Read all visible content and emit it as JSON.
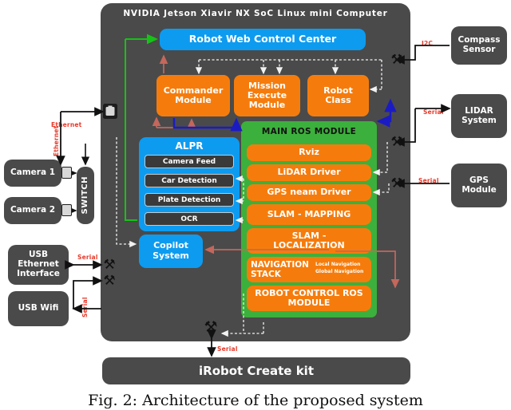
{
  "figure": {
    "caption": "Fig. 2: Architecture of the proposed system"
  },
  "soc": {
    "title": "NVIDIA Jetson Xiavir NX SoC Linux mini Computer",
    "web_control_center": "Robot Web Control Center",
    "modules": [
      {
        "label": "Commander Module"
      },
      {
        "label": "Mission Execute Module"
      },
      {
        "label": "Robot Class"
      }
    ],
    "alpr": {
      "title": "ALPR",
      "items": [
        "Camera Feed",
        "Car Detection",
        "Plate Detection",
        "OCR"
      ]
    },
    "copilot": "Copilot System",
    "ros": {
      "title": "MAIN ROS MODULE",
      "items": [
        {
          "label": "Rviz"
        },
        {
          "label": "LiDAR Driver"
        },
        {
          "label": "GPS neam Driver"
        },
        {
          "label": "SLAM - MAPPING"
        },
        {
          "label": "SLAM - LOCALIZATION"
        },
        {
          "label": "NAVIGATION STACK",
          "sub1": "Local Navigation",
          "sub2": "Global Navigation"
        },
        {
          "label": "ROBOT CONTROL ROS MODULE"
        }
      ]
    }
  },
  "left_devices": [
    {
      "label": "Camera 1"
    },
    {
      "label": "Camera 2"
    },
    {
      "label": "USB Ethernet Interface"
    },
    {
      "label": "USB Wifi"
    }
  ],
  "switch": {
    "label": "SWITCH"
  },
  "right_devices": [
    {
      "label": "Compass Sensor",
      "bus": "I2C"
    },
    {
      "label": "LIDAR System",
      "bus": "Serial"
    },
    {
      "label": "GPS Module",
      "bus": "Serial"
    }
  ],
  "base": {
    "label": "iRobot Create kit",
    "bus": "Serial"
  },
  "bus_labels": {
    "ethernet": "Ethernet",
    "serial_usb_eth": "Serial",
    "serial_usb_wifi": "Serial"
  },
  "colors": {
    "blue": "#0d9bf0",
    "orange": "#f57c0c",
    "green": "#3cb03c",
    "dark": "#4a4a4a",
    "subdark": "#3a3a3a",
    "red": "#e8392a",
    "arrow_red": "#c4675c",
    "arrow_blue": "#1b1bc4",
    "arrow_green": "#16c216"
  }
}
